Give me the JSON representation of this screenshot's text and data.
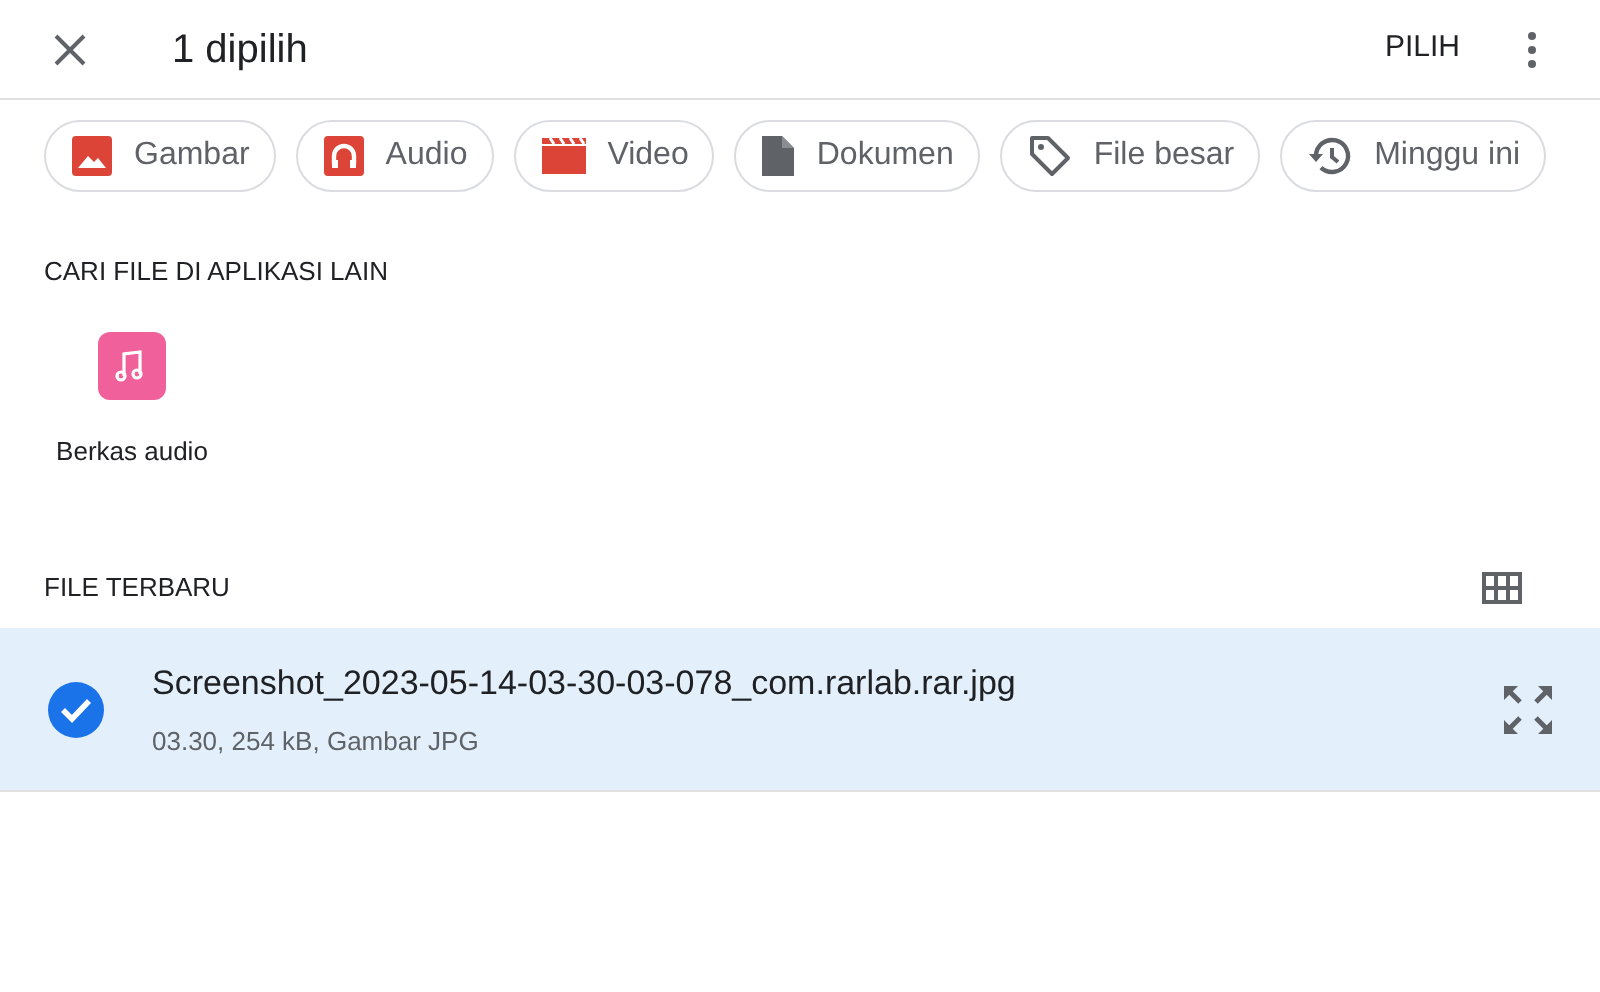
{
  "header": {
    "title": "1 dipilih",
    "action": "PILIH"
  },
  "filters": [
    {
      "kind": "image",
      "label": "Gambar"
    },
    {
      "kind": "audio",
      "label": "Audio"
    },
    {
      "kind": "video",
      "label": "Video"
    },
    {
      "kind": "document",
      "label": "Dokumen"
    },
    {
      "kind": "tag",
      "label": "File besar"
    },
    {
      "kind": "history",
      "label": "Minggu ini"
    }
  ],
  "other_apps": {
    "heading": "CARI FILE DI APLIKASI LAIN",
    "apps": [
      {
        "label": "Berkas audio"
      }
    ]
  },
  "recent": {
    "heading": "FILE TERBARU",
    "files": [
      {
        "name": "Screenshot_2023-05-14-03-30-03-078_com.rarlab.rar.jpg",
        "details": "03.30, 254 kB, Gambar JPG",
        "selected": true
      }
    ]
  }
}
